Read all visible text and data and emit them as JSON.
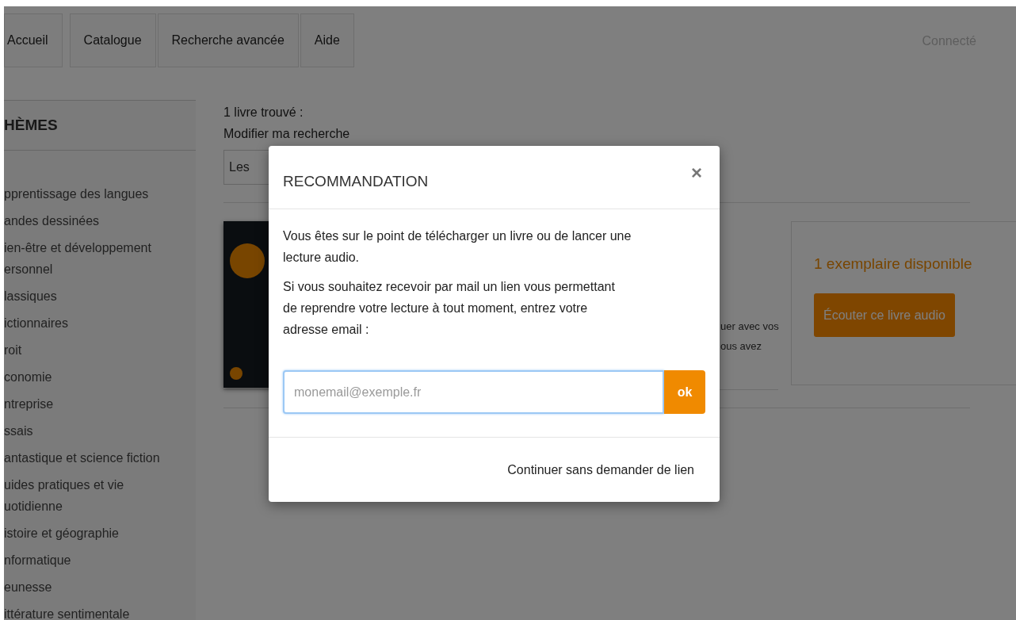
{
  "nav": {
    "tabs": [
      {
        "label": "Accueil"
      },
      {
        "label": "Catalogue"
      },
      {
        "label": "Recherche avancée"
      },
      {
        "label": "Aide"
      }
    ],
    "user_status": "Connecté"
  },
  "sidebar": {
    "title": "HÈMES",
    "items": [
      {
        "lines": [
          "pprentissage des langues"
        ]
      },
      {
        "lines": [
          "andes dessinées"
        ]
      },
      {
        "lines": [
          "ien-être et développement",
          "ersonnel"
        ]
      },
      {
        "lines": [
          "lassiques"
        ]
      },
      {
        "lines": [
          "ictionnaires"
        ]
      },
      {
        "lines": [
          "roit"
        ]
      },
      {
        "lines": [
          "conomie"
        ]
      },
      {
        "lines": [
          "ntreprise"
        ]
      },
      {
        "lines": [
          "ssais"
        ]
      },
      {
        "lines": [
          "antastique et science fiction"
        ]
      },
      {
        "lines": [
          "uides pratiques et vie",
          "uotidienne"
        ]
      },
      {
        "lines": [
          "istoire et géographie"
        ]
      },
      {
        "lines": [
          "nformatique"
        ]
      },
      {
        "lines": [
          "eunesse"
        ]
      },
      {
        "lines": [
          "ittérature sentimentale"
        ]
      }
    ]
  },
  "results": {
    "count": "1 livre trouvé :",
    "modify_link": "Modifier ma recherche",
    "sort_select": {
      "value": "Les"
    },
    "book": {
      "description_lines": [
        "uer avec vos",
        "ous avez"
      ],
      "availability": "1 exemplaire disponible",
      "action_button": "Écouter ce livre audio"
    }
  },
  "modal": {
    "title": "RECOMMANDATION",
    "close": "×",
    "paragraphs": [
      [
        "Vous êtes sur le point de télécharger un livre ou de lancer une",
        "lecture audio."
      ],
      [
        "Si vous souhaitez recevoir par mail un lien vous permettant",
        "de reprendre votre lecture à tout moment, entrez votre",
        "adresse email :"
      ]
    ],
    "email_field": {
      "placeholder": "monemail@exemple.fr"
    },
    "submit_button": "ok",
    "footer_link": "Continuer sans demander de lien"
  }
}
